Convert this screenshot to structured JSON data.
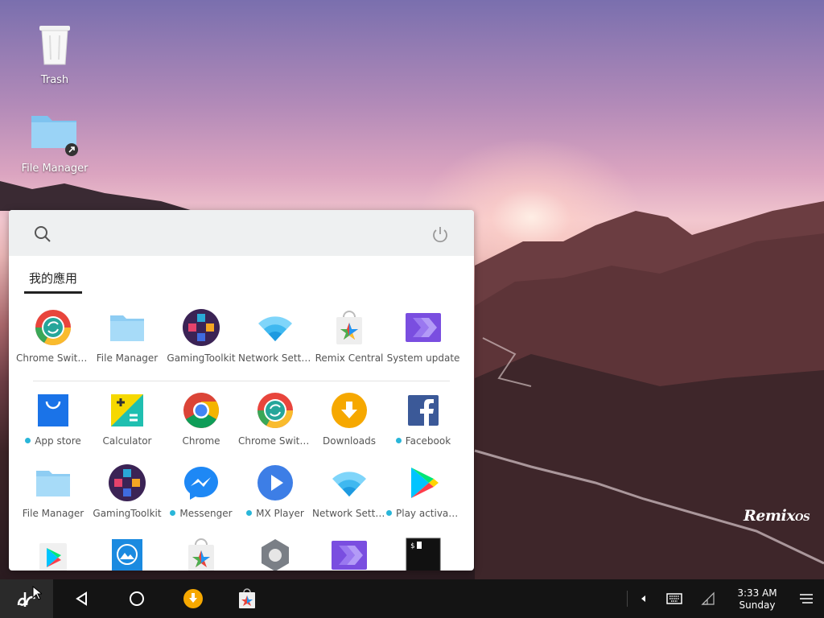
{
  "desktop": {
    "icons": [
      {
        "label": "Trash"
      },
      {
        "label": "File Manager"
      }
    ],
    "brand": "Remix OS"
  },
  "launcher": {
    "tab_label": "我的應用",
    "recent_apps": [
      {
        "label": "Chrome Switc...",
        "icon": "chrome-switch-icon",
        "new": false
      },
      {
        "label": "File Manager",
        "icon": "folder-icon",
        "new": false
      },
      {
        "label": "GamingToolkit",
        "icon": "gaming-toolkit-icon",
        "new": false
      },
      {
        "label": "Network Setti...",
        "icon": "wifi-icon",
        "new": false
      },
      {
        "label": "Remix Central",
        "icon": "remix-central-icon",
        "new": false
      },
      {
        "label": "System update",
        "icon": "system-update-icon",
        "new": false
      }
    ],
    "apps_row1": [
      {
        "label": "App store",
        "icon": "app-store-icon",
        "new": true
      },
      {
        "label": "Calculator",
        "icon": "calculator-icon",
        "new": false
      },
      {
        "label": "Chrome",
        "icon": "chrome-icon",
        "new": false
      },
      {
        "label": "Chrome Switc...",
        "icon": "chrome-switch-icon",
        "new": false
      },
      {
        "label": "Downloads",
        "icon": "downloads-icon",
        "new": false
      },
      {
        "label": "Facebook",
        "icon": "facebook-icon",
        "new": true
      }
    ],
    "apps_row2": [
      {
        "label": "File Manager",
        "icon": "folder-icon",
        "new": false
      },
      {
        "label": "GamingToolkit",
        "icon": "gaming-toolkit-icon",
        "new": false
      },
      {
        "label": "Messenger",
        "icon": "messenger-icon",
        "new": true
      },
      {
        "label": "MX Player",
        "icon": "mx-player-icon",
        "new": true
      },
      {
        "label": "Network Setti...",
        "icon": "wifi-icon",
        "new": false
      },
      {
        "label": "Play activat...",
        "icon": "play-icon",
        "new": true
      }
    ],
    "apps_row3_icons": [
      "play-store-icon",
      "gallery-icon",
      "remix-central-icon",
      "settings-icon",
      "system-update-icon",
      "terminal-icon"
    ]
  },
  "taskbar": {
    "time": "3:33 AM",
    "day": "Sunday"
  },
  "colors": {
    "taskbar_bg": "#141414",
    "launcher_header": "#eef0f1",
    "new_dot": "#29b6d9"
  }
}
